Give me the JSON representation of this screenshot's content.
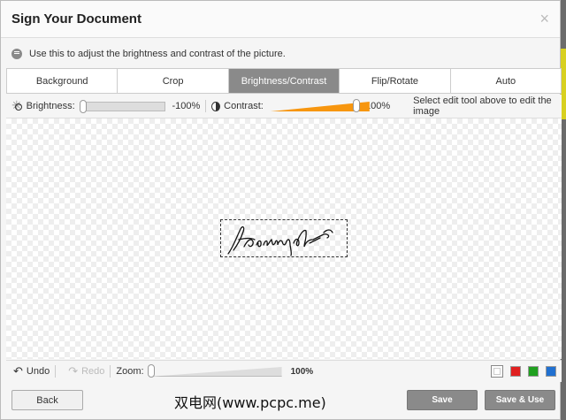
{
  "dialog": {
    "title": "Sign Your Document",
    "close_glyph": "×"
  },
  "info": {
    "text": "Use this to adjust the brightness and contrast of the picture.",
    "icon": "chat-bubble-icon"
  },
  "tabs": [
    {
      "label": "Background",
      "active": false
    },
    {
      "label": "Crop",
      "active": false
    },
    {
      "label": "Brightness/Contrast",
      "active": true
    },
    {
      "label": "Flip/Rotate",
      "active": false
    },
    {
      "label": "Auto",
      "active": false
    }
  ],
  "adjust": {
    "brightness_label": "Brightness:",
    "brightness_value": "-100%",
    "brightness_level": 0.0,
    "contrast_label": "Contrast:",
    "contrast_value": "100%",
    "contrast_level": 1.0,
    "hint": "Select edit tool above to edit the image"
  },
  "tools": {
    "undo_label": "Undo",
    "redo_label": "Redo",
    "zoom_label": "Zoom:",
    "zoom_value": "100%",
    "zoom_level": 0.0,
    "swatches": [
      {
        "name": "transparent",
        "color": "#ffffff",
        "selected": true
      },
      {
        "name": "red",
        "color": "#e02020",
        "selected": false
      },
      {
        "name": "green",
        "color": "#20a020",
        "selected": false
      },
      {
        "name": "blue",
        "color": "#2070d0",
        "selected": false
      }
    ]
  },
  "buttons": {
    "back": "Back",
    "save": "Save",
    "save_use": "Save & Use"
  },
  "watermark": "双电网(www.pcpc.me)",
  "colors": {
    "accent": "#f7960f",
    "active_tab": "#8a8a8a"
  }
}
